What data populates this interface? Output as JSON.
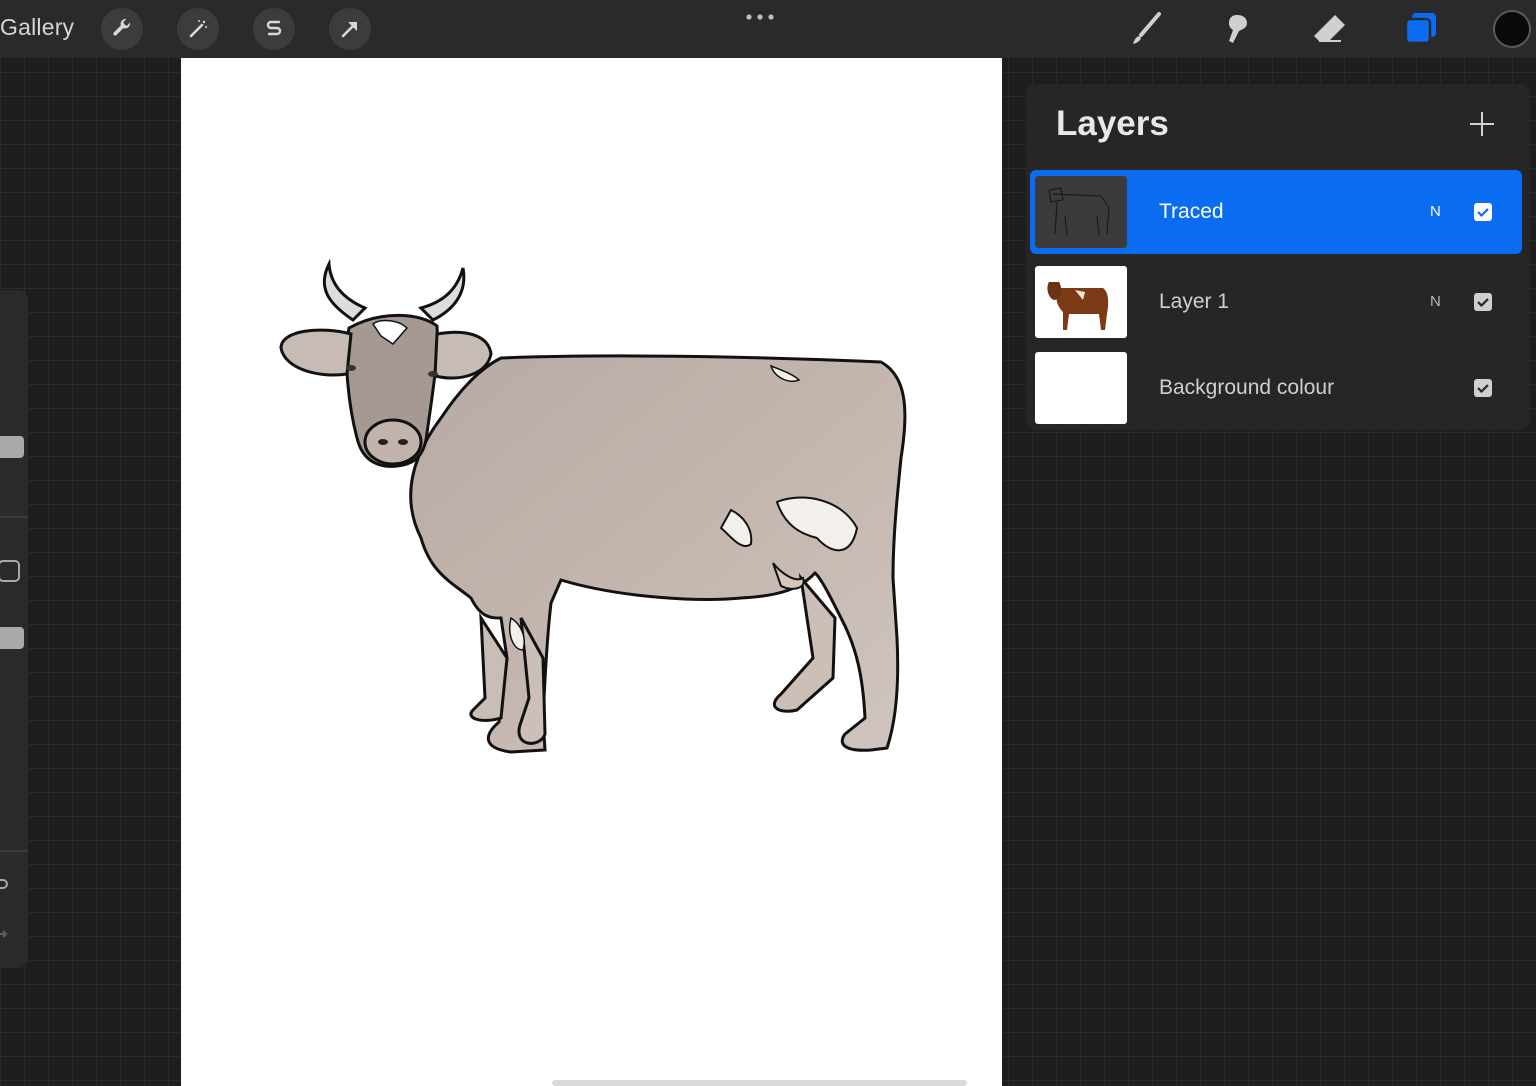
{
  "topbar": {
    "gallery_label": "Gallery",
    "tools_left": [
      "wrench-icon",
      "magic-wand-icon",
      "selection-s-icon",
      "arrow-transform-icon"
    ],
    "more_icon": "ellipsis-icon",
    "tools_right": [
      "brush-icon",
      "smudge-icon",
      "eraser-icon",
      "layers-icon"
    ],
    "accent_color": "#0a6cf0",
    "current_color": "#0a0a0a"
  },
  "layers": {
    "title": "Layers",
    "add_icon": "plus-icon",
    "items": [
      {
        "name": "Traced",
        "blend": "N",
        "visible": true,
        "selected": true
      },
      {
        "name": "Layer 1",
        "blend": "N",
        "visible": true,
        "selected": false
      },
      {
        "name": "Background colour",
        "blend": "",
        "visible": true,
        "selected": false
      }
    ]
  },
  "colors": {
    "panel": "#262628",
    "toolbar": "#2a2a2c",
    "selection": "#0a6cf0",
    "canvas": "#ffffff"
  }
}
